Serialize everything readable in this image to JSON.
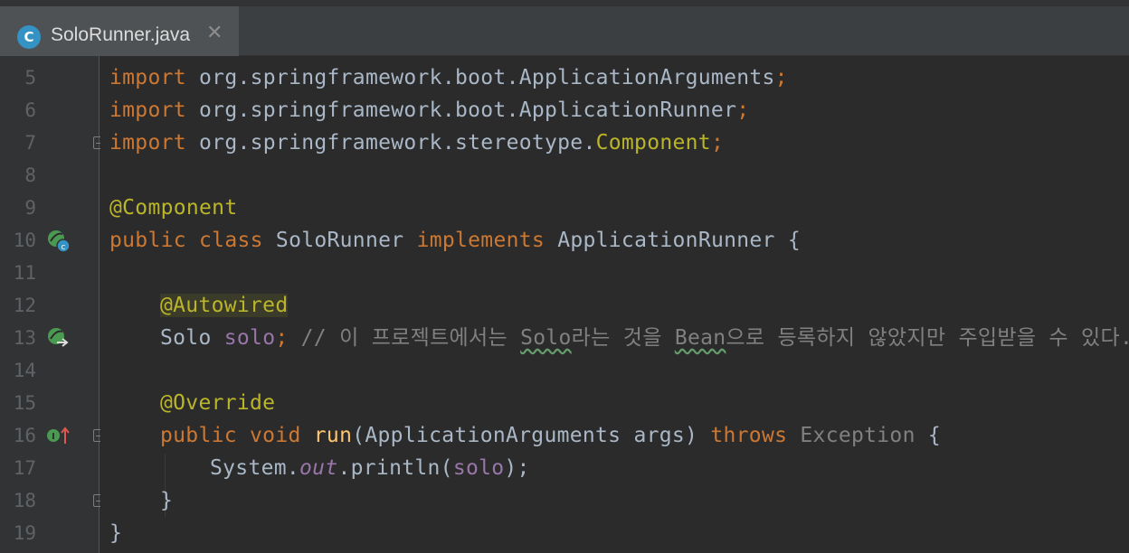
{
  "tab": {
    "icon_letter": "C",
    "file_name": "SoloRunner.java",
    "close_glyph": "✕"
  },
  "gutter": {
    "line_numbers": [
      "5",
      "6",
      "7",
      "8",
      "9",
      "10",
      "11",
      "12",
      "13",
      "14",
      "15",
      "16",
      "17",
      "18",
      "19"
    ]
  },
  "code": {
    "l5": {
      "kw": "import",
      "path": " org.springframework.boot.ApplicationArguments",
      "semi": ";"
    },
    "l6": {
      "kw": "import",
      "path": " org.springframework.boot.ApplicationRunner",
      "semi": ";"
    },
    "l7": {
      "kw": "import",
      "path": " org.springframework.stereotype.",
      "cls": "Component",
      "semi": ";"
    },
    "l9": {
      "ann": "@Component"
    },
    "l10": {
      "kw1": "public class",
      "name": " SoloRunner ",
      "kw2": "implements",
      "rest": " ApplicationRunner {"
    },
    "l12": {
      "ann": "@Autowired"
    },
    "l13": {
      "type": "Solo ",
      "field": "solo",
      "semi": ";",
      "c1": " // 이 프로젝트에서는 ",
      "c2": "Solo",
      "c3": "라는 것을 ",
      "c4": "Bean",
      "c5": "으로 등록하지 않았지만 주입받을 수 있다."
    },
    "l15": {
      "ann": "@Override"
    },
    "l16": {
      "kw1": "public void ",
      "method": "run",
      "params": "(ApplicationArguments args) ",
      "kw2": "throws",
      "exc": " Exception",
      "brace": " {"
    },
    "l17": {
      "sys": "System.",
      "out": "out",
      "call": ".println(",
      "arg": "solo",
      "end": ");"
    },
    "l18": {
      "brace": "}"
    },
    "l19": {
      "brace": "}"
    }
  },
  "colors": {
    "background": "#2b2b2b",
    "keyword": "#cc7832",
    "annotation": "#bbb529",
    "method": "#ffc66d",
    "field": "#9876aa",
    "comment": "#808080",
    "text": "#a9b7c6"
  }
}
